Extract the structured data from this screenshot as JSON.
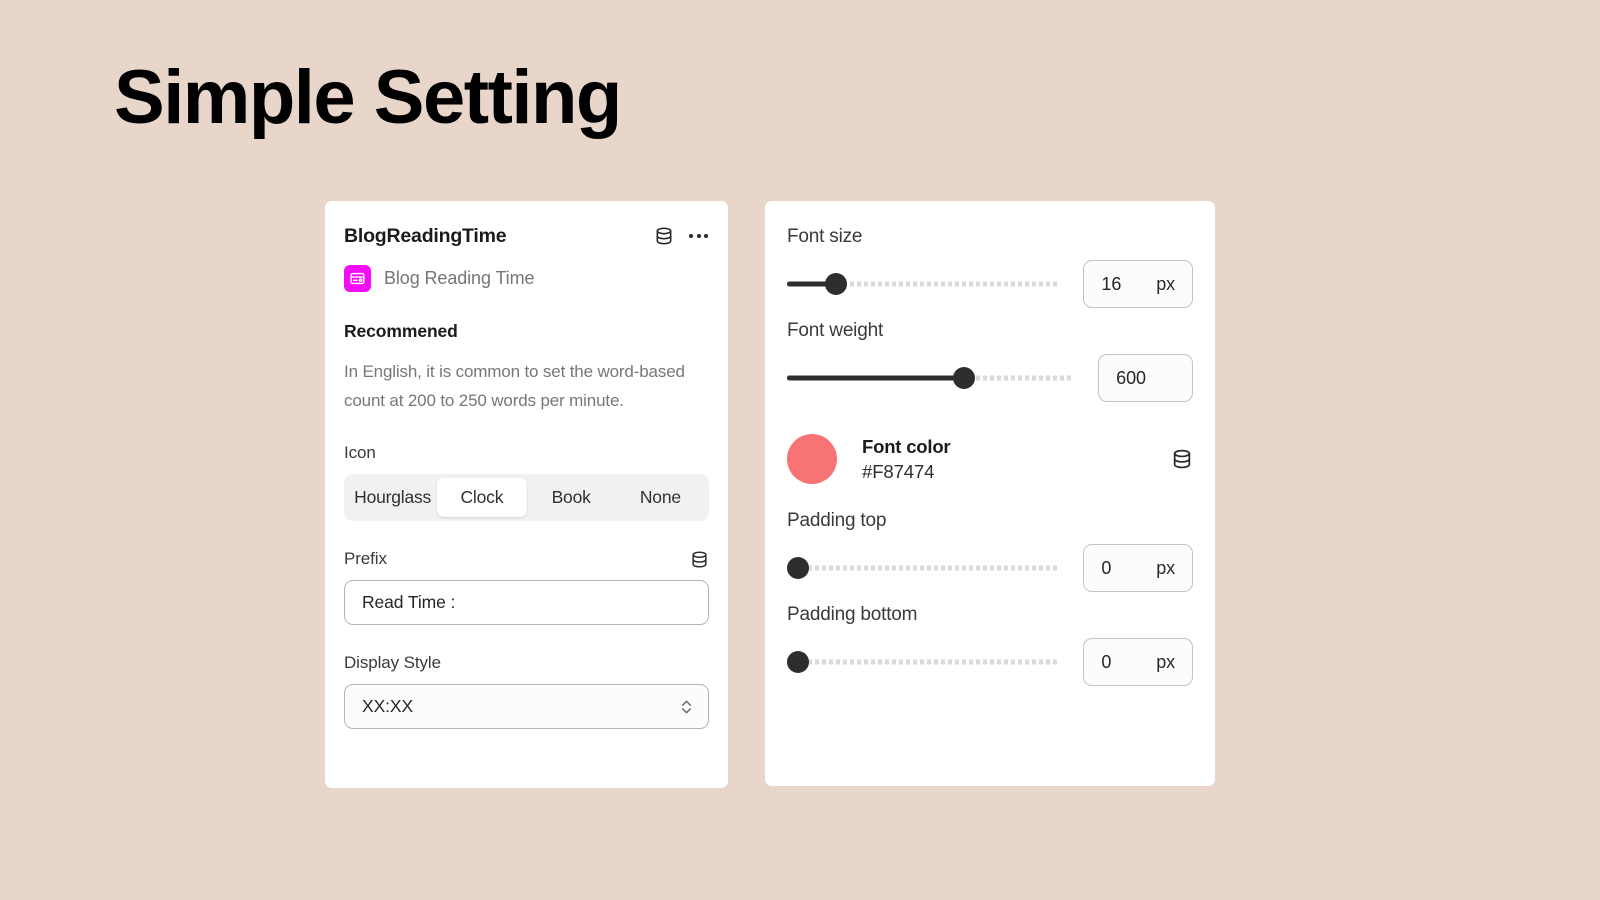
{
  "page": {
    "title": "Simple Setting",
    "background_color": "#E8D6CA"
  },
  "left_panel": {
    "header": {
      "title": "BlogReadingTime",
      "database_icon": "database-icon",
      "menu_icon": "more-options-icon"
    },
    "app": {
      "icon": "blog-reading-time-app-icon",
      "icon_color": "#F40CF4",
      "name": "Blog Reading Time"
    },
    "recommended": {
      "heading": "Recommened",
      "body": "In English, it is common to set the word-based count at 200 to 250 words per minute."
    },
    "icon_field": {
      "label": "Icon",
      "options": [
        "Hourglass",
        "Clock",
        "Book",
        "None"
      ],
      "selected": "Clock"
    },
    "prefix_field": {
      "label": "Prefix",
      "value": "Read Time :",
      "placeholder": "Read Time :",
      "database_icon": "database-icon"
    },
    "display_style_field": {
      "label": "Display Style",
      "value": "XX:XX",
      "stepper_icon": "chevron-up-down-icon"
    }
  },
  "right_panel": {
    "font_size": {
      "label": "Font size",
      "value": "16",
      "unit": "px",
      "slider_percent": 18
    },
    "font_weight": {
      "label": "Font weight",
      "value": "600",
      "unit": "",
      "slider_percent": 62
    },
    "font_color": {
      "label": "Font color",
      "hex": "#F87474",
      "swatch_color": "#F87474",
      "database_icon": "database-icon"
    },
    "padding_top": {
      "label": "Padding top",
      "value": "0",
      "unit": "px",
      "slider_percent": 0
    },
    "padding_bottom": {
      "label": "Padding bottom",
      "value": "0",
      "unit": "px",
      "slider_percent": 0
    }
  }
}
